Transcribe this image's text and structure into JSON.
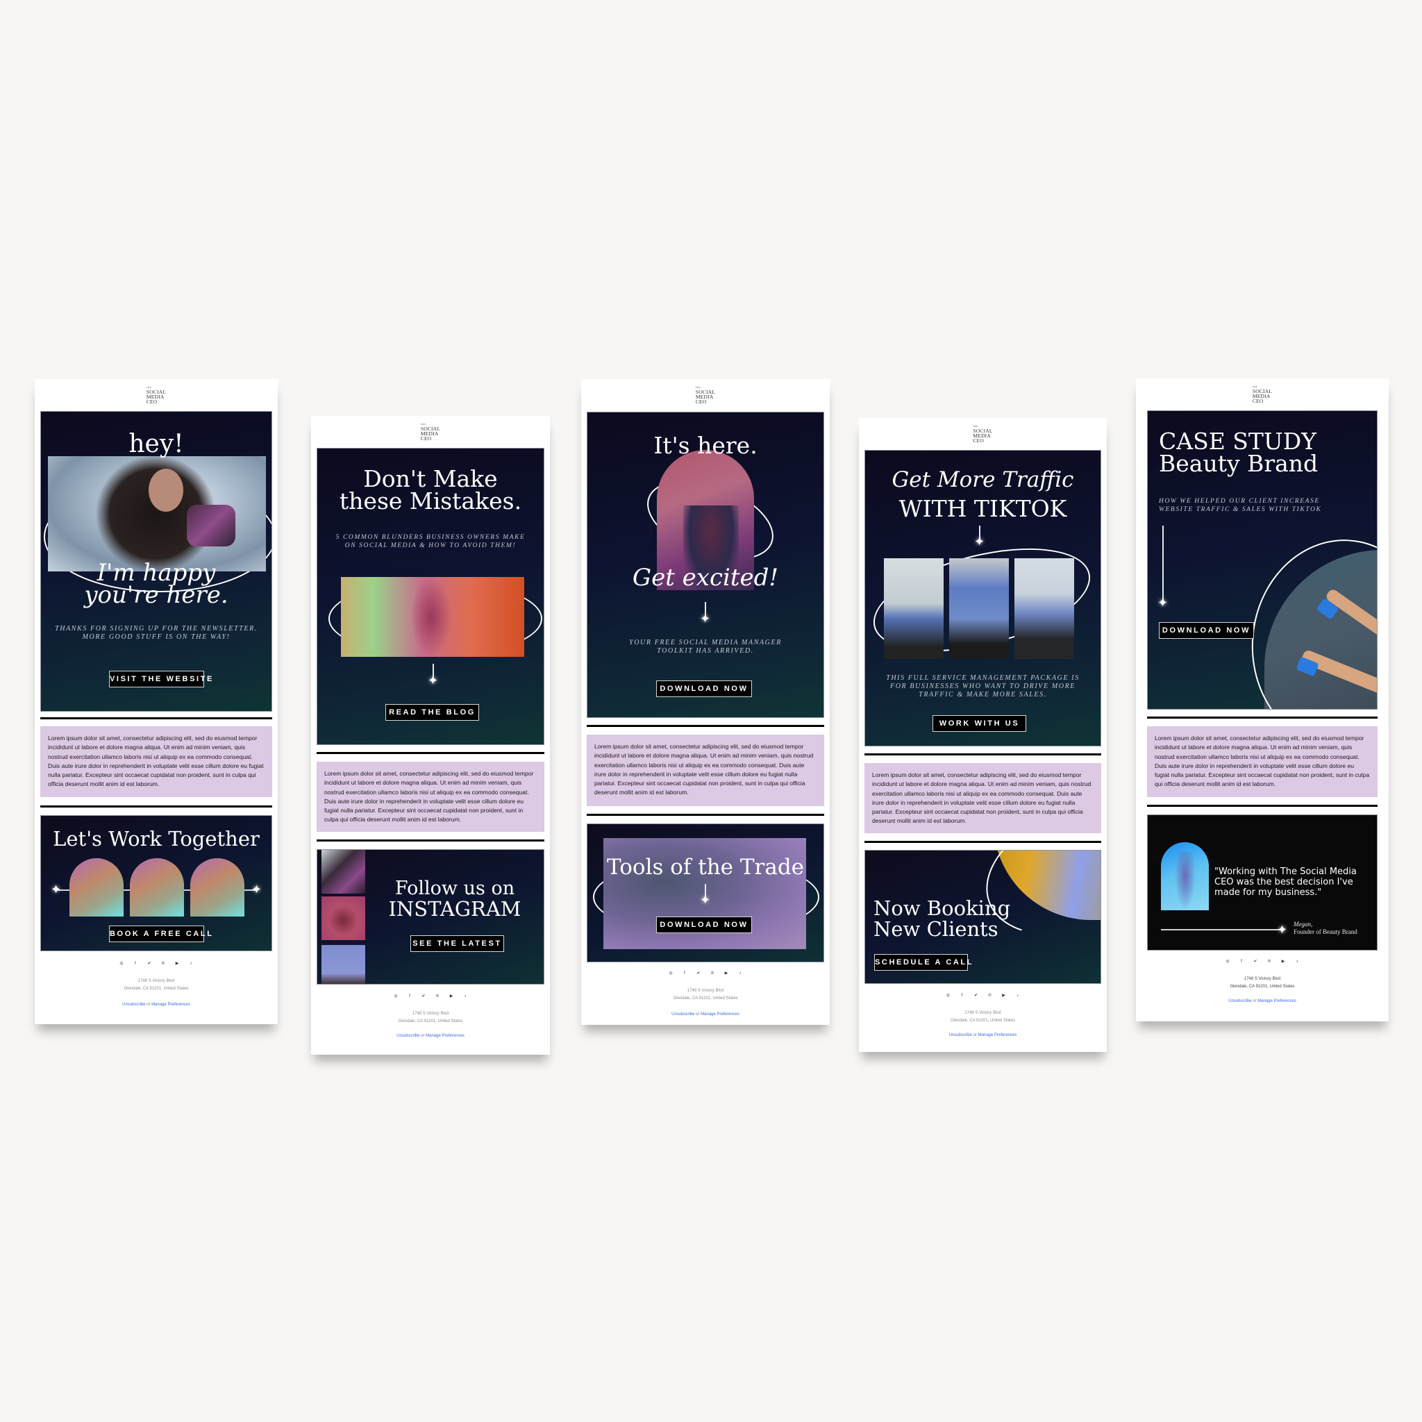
{
  "brand": {
    "logo_the": "THE",
    "logo_lines": [
      "SOCIAL",
      "MEDIA",
      "CEO"
    ]
  },
  "common": {
    "lorem": "Lorem ipsum dolor sit amet, consectetur adipiscing elit, sed do eiusmod tempor incididunt ut labore et dolore magna aliqua. Ut enim ad minim veniam, quis nostrud exercitation ullamco laboris nisi ut aliquip ex ea commodo consequat. Duis aute irure dolor in reprehenderit in voluptate velit esse cillum dolore eu fugiat nulla pariatur. Excepteur sint occaecat cupidatat non proident, sunt in culpa qui officia deserunt mollit anim id est laborum.",
    "socials": [
      "instagram-icon",
      "facebook-icon",
      "twitter-icon",
      "pinterest-icon",
      "youtube-icon",
      "tiktok-icon"
    ],
    "social_glyphs": [
      "◎",
      "f",
      "✔",
      "℗",
      "▶",
      "♪"
    ],
    "address_line1": "1748 S Victory Blvd",
    "address_line2": "Glendale, CA 91201, United States",
    "unsubscribe": "Unsubscribe",
    "or": "or",
    "manage_preferences": "Manage Preferences"
  },
  "colors": {
    "lilac": "#dcc9e4",
    "navy": "#0d1330",
    "teal": "#0f3434",
    "link": "#3b6ae0"
  },
  "emails": [
    {
      "hero_title_top": "hey!",
      "hero_title_bottom_1": "I'm happy",
      "hero_title_bottom_2": "you're here.",
      "subtitle_1": "Thanks for signing up for the newsletter.",
      "subtitle_2": "More good stuff is on the way!",
      "hero_button": "VISIT THE WEBSITE",
      "promo_title": "Let's Work Together",
      "promo_button": "BOOK A FREE CALL"
    },
    {
      "hero_title_1": "Don't Make",
      "hero_title_2": "these Mistakes.",
      "subtitle_1": "5 common blunders business owners make",
      "subtitle_2": "on social media & how to avoid them!",
      "hero_button": "READ THE BLOG",
      "promo_title_1": "Follow us on",
      "promo_title_2": "INSTAGRAM",
      "promo_button": "SEE THE LATEST"
    },
    {
      "hero_title_top": "It's here.",
      "hero_title_bottom": "Get excited!",
      "subtitle_1": "Your free social media manager",
      "subtitle_2": "toolkit has arrived.",
      "hero_button": "DOWNLOAD NOW",
      "promo_title": "Tools of the Trade",
      "promo_button": "DOWNLOAD NOW"
    },
    {
      "hero_title_1": "Get More Traffic",
      "hero_title_2": "WITH TIKTOK",
      "subtitle_1": "This full service management package is",
      "subtitle_2": "for businesses who want to drive more",
      "subtitle_3": "traffic & make more sales.",
      "hero_button": "WORK WITH US",
      "promo_title_1": "Now Booking",
      "promo_title_2": "New Clients",
      "promo_button": "SCHEDULE A CALL"
    },
    {
      "hero_title_1": "CASE STUDY",
      "hero_title_2": "Beauty Brand",
      "subtitle_1": "How we helped our client increase",
      "subtitle_2": "website traffic & sales with TikTok",
      "hero_button": "DOWNLOAD NOW",
      "testimonial_quote": "\"Working with The Social Media CEO was the best decision I've made for my business.\"",
      "testimonial_name": "Megan,",
      "testimonial_role": "Founder of Beauty Brand"
    }
  ]
}
